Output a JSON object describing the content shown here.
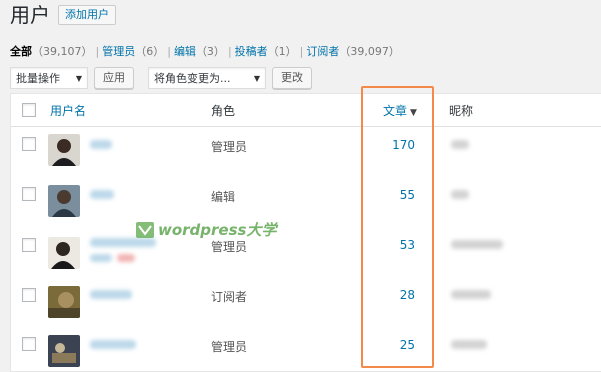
{
  "header": {
    "title": "用户",
    "add_new": "添加用户"
  },
  "filters": [
    {
      "label": "全部",
      "count": "（39,107）",
      "current": true
    },
    {
      "label": "管理员",
      "count": "（6）",
      "current": false
    },
    {
      "label": "编辑",
      "count": "（3）",
      "current": false
    },
    {
      "label": "投稿者",
      "count": "（1）",
      "current": false
    },
    {
      "label": "订阅者",
      "count": "（39,097）",
      "current": false
    }
  ],
  "actions": {
    "bulk_select": "批量操作",
    "apply": "应用",
    "role_select": "将角色变更为...",
    "change": "更改"
  },
  "table": {
    "columns": {
      "username": "用户名",
      "role": "角色",
      "posts": "文章",
      "nickname": "昵称"
    },
    "rows": [
      {
        "role": "管理员",
        "posts": "170"
      },
      {
        "role": "编辑",
        "posts": "55"
      },
      {
        "role": "管理员",
        "posts": "53"
      },
      {
        "role": "订阅者",
        "posts": "28"
      },
      {
        "role": "管理员",
        "posts": "25"
      }
    ]
  },
  "watermark": {
    "text": "wordpress大学"
  },
  "colors": {
    "link": "#0073aa",
    "highlight_border": "#f48a4a",
    "watermark_green": "#4a9a3a"
  }
}
